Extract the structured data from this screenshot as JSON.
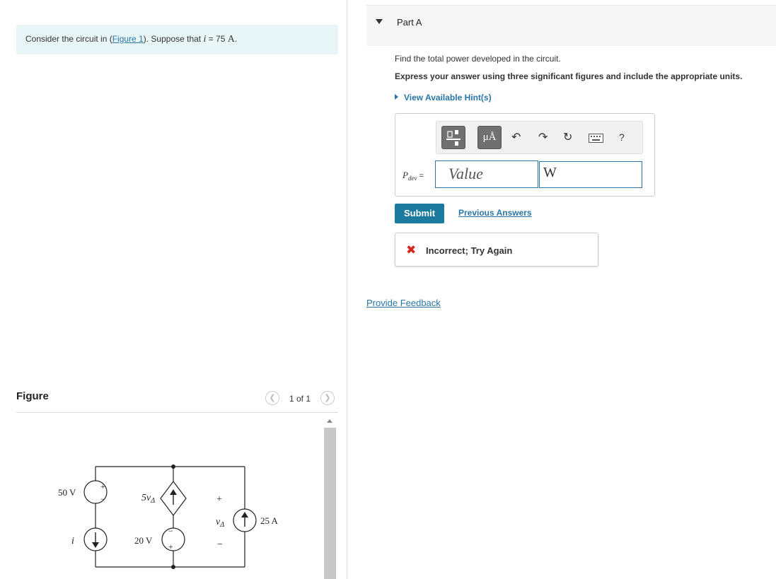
{
  "problem": {
    "prefix": "Consider the circuit in (",
    "figure_link": "Figure 1",
    "suffix": "). Suppose that ",
    "var": "i",
    "equals": " = 75 ",
    "unit": "A",
    "end": "."
  },
  "figure": {
    "title": "Figure",
    "pager": "1 of 1",
    "prev_icon": "chevron-left-icon",
    "next_icon": "chevron-right-icon",
    "labels": {
      "v50": "50 V",
      "i": "i",
      "dep_src": "5v",
      "dep_sub": "Δ",
      "v20": "20 V",
      "plus": "+",
      "minus": "−",
      "vdelta": "v",
      "vdelta_sub": "Δ",
      "a25": "25 A"
    }
  },
  "part": {
    "title": "Part A",
    "question": "Find the total power developed in the circuit.",
    "instruction": "Express your answer using three significant figures and include the appropriate units.",
    "hint_label": "View Available Hint(s)",
    "toolbar": {
      "template_icon": "fraction-template-icon",
      "units_btn": "μÅ",
      "undo_icon": "undo-icon",
      "redo_icon": "redo-icon",
      "reset_icon": "reset-icon",
      "keyboard_icon": "keyboard-icon",
      "help": "?"
    },
    "var_label": "P",
    "var_sub": "dev",
    "equals": "=",
    "value_placeholder": "Value",
    "unit_value": "W",
    "submit_label": "Submit",
    "previous_answers": "Previous Answers",
    "result_icon": "x-icon",
    "result_text": "Incorrect; Try Again"
  },
  "provide_feedback": "Provide Feedback",
  "colors": {
    "accent": "#1d7a9f",
    "link": "#2a74a6",
    "error": "#d9261c",
    "problem_bg": "#e9f6f7"
  }
}
